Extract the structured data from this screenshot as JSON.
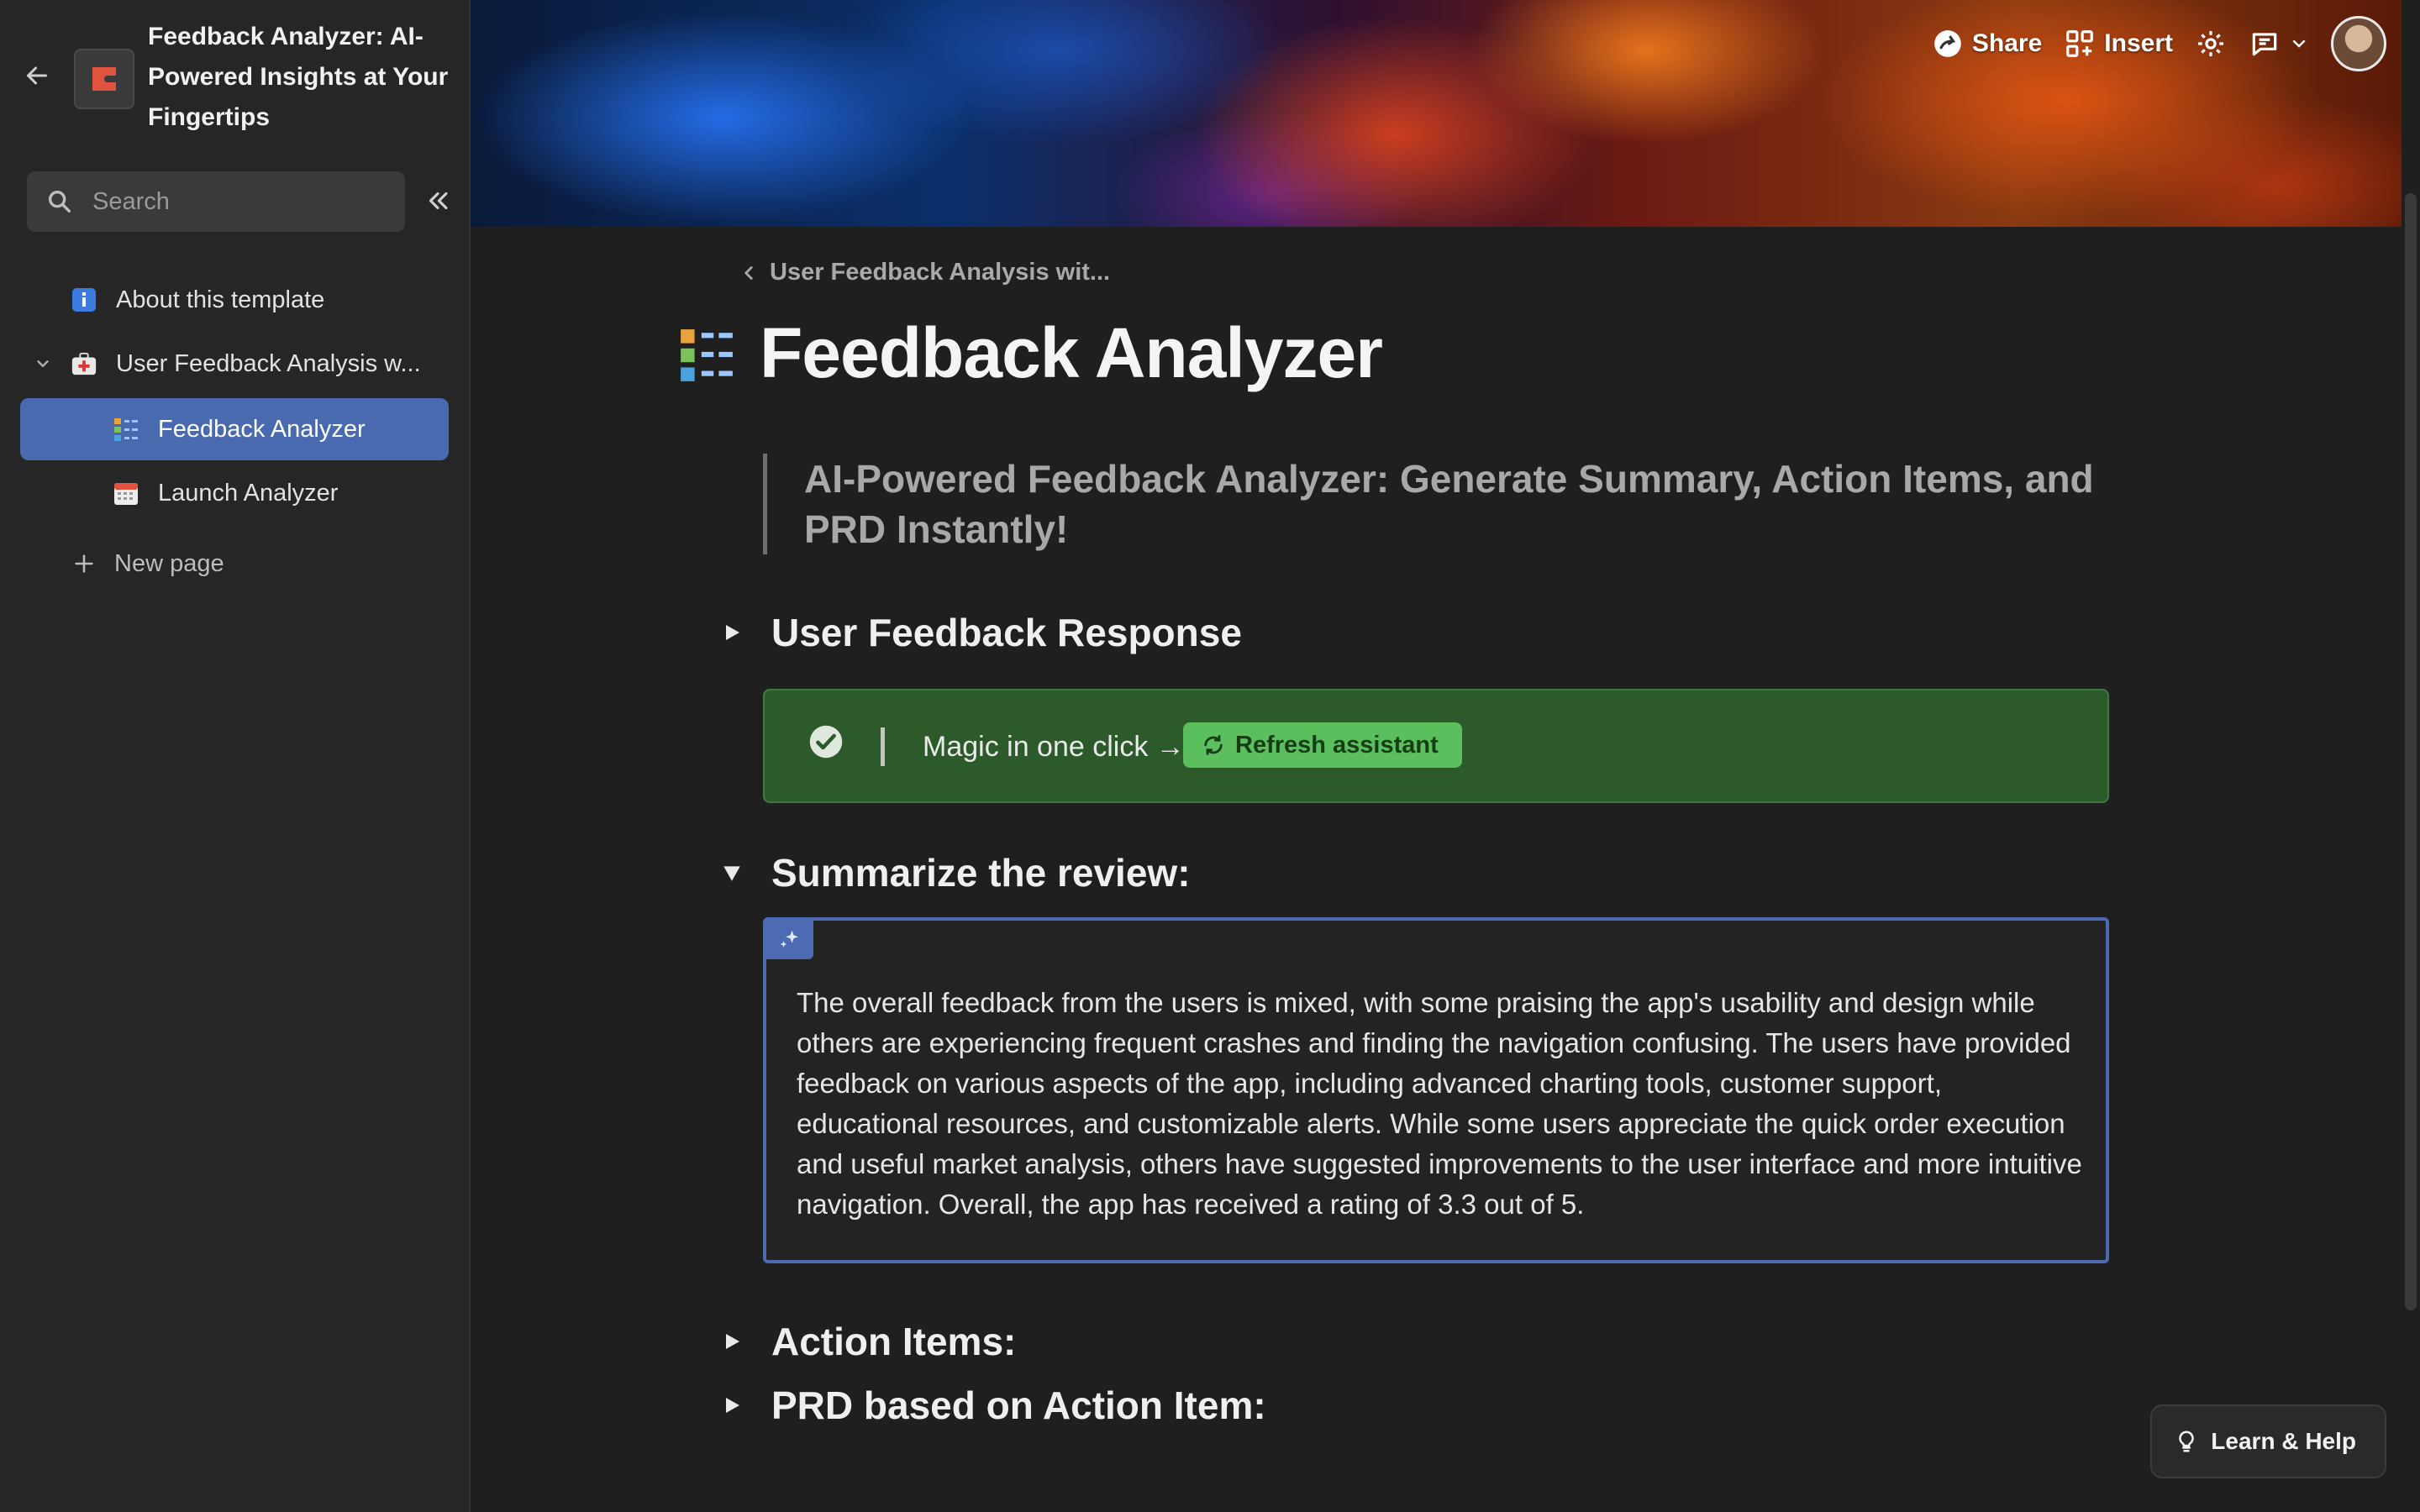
{
  "sidebar": {
    "doc_title": "Feedback Analyzer: AI-Powered Insights at Your Fingertips",
    "search_placeholder": "Search",
    "items": [
      {
        "label": "About this template",
        "icon": "info-icon"
      },
      {
        "label": "User Feedback Analysis w...",
        "icon": "medical-bag-icon"
      },
      {
        "label": "Feedback Analyzer",
        "icon": "checklist-icon"
      },
      {
        "label": "Launch Analyzer",
        "icon": "calendar-icon"
      }
    ],
    "new_page_label": "New page"
  },
  "header": {
    "share_label": "Share",
    "insert_label": "Insert"
  },
  "page": {
    "breadcrumb": "User Feedback Analysis wit...",
    "title": "Feedback Analyzer",
    "quote": "AI-Powered Feedback Analyzer: Generate Summary, Action Items, and PRD Instantly!",
    "section_user_feedback": "User Feedback Response",
    "callout_text": "Magic in one click →",
    "refresh_label": "Refresh assistant",
    "section_summarize": "Summarize the review:",
    "summary_text": "The overall feedback from the users is mixed, with some praising the app's usability and design while others are experiencing frequent crashes and finding the navigation confusing. The users have provided feedback on various aspects of the app, including advanced charting tools, customer support, educational resources, and customizable alerts. While some users appreciate the quick order execution and useful market analysis, others have suggested improvements to the user interface and more intuitive navigation. Overall, the app has received a rating of 3.3 out of 5.",
    "section_action_items": "Action Items:",
    "section_prd": "PRD based on Action Item:"
  },
  "help": {
    "label": "Learn & Help"
  },
  "colors": {
    "accent": "#4a6ab0",
    "callout_bg": "#2c5a2a",
    "button_green": "#5bbf5e"
  }
}
